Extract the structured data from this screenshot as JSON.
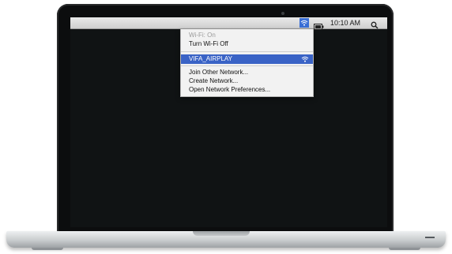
{
  "menubar": {
    "wifi_icon": "wifi-icon",
    "battery_icon": "battery-icon",
    "time": "10:10 AM",
    "search_icon": "search-icon",
    "accent": "#3a6fd6"
  },
  "wifi_menu": {
    "status": "Wi-Fi: On",
    "toggle": "Turn Wi-Fi Off",
    "network": "VIFA_AIRPLAY",
    "network_icon": "wifi-icon",
    "join": "Join Other Network...",
    "create": "Create Network...",
    "preferences": "Open Network Preferences...",
    "highlight_color": "#3a63c6"
  }
}
